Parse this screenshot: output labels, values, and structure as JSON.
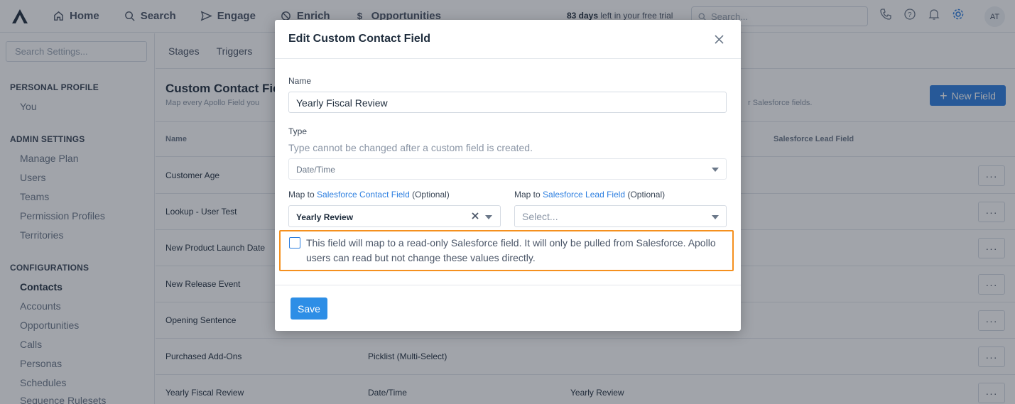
{
  "topbar": {
    "nav": [
      {
        "label": "Home",
        "icon": "home-icon"
      },
      {
        "label": "Search",
        "icon": "search-icon"
      },
      {
        "label": "Engage",
        "icon": "send-icon"
      },
      {
        "label": "Enrich",
        "icon": "enrich-icon"
      },
      {
        "label": "Opportunities",
        "icon": "dollar-icon"
      }
    ],
    "trial_days": "83 days",
    "trial_rest": " left in your free trial",
    "search_placeholder": "Search...",
    "avatar_initials": "AT"
  },
  "sidebar": {
    "search_placeholder": "Search Settings...",
    "sections": [
      {
        "title": "PERSONAL PROFILE",
        "items": [
          "You"
        ]
      },
      {
        "title": "ADMIN SETTINGS",
        "items": [
          "Manage Plan",
          "Users",
          "Teams",
          "Permission Profiles",
          "Territories"
        ]
      },
      {
        "title": "CONFIGURATIONS",
        "items": [
          "Contacts",
          "Accounts",
          "Opportunities",
          "Calls",
          "Personas",
          "Schedules",
          "Sequence Rulesets"
        ]
      }
    ],
    "active_item": "Contacts"
  },
  "main": {
    "tabs": [
      "Stages",
      "Triggers"
    ],
    "title": "Custom Contact Fie",
    "subtitle": "Map every Apollo Field you",
    "subtitle_right": "r Salesforce fields.",
    "new_field_label": "New Field",
    "columns": {
      "name": "Name",
      "lead": "Salesforce Lead Field"
    },
    "rows": [
      {
        "name": "Customer Age",
        "type": "",
        "contact": ""
      },
      {
        "name": "Lookup - User Test",
        "type": "",
        "contact": ""
      },
      {
        "name": "New Product Launch Date",
        "type": "",
        "contact": ""
      },
      {
        "name": "New Release Event",
        "type": "",
        "contact": ""
      },
      {
        "name": "Opening Sentence",
        "type": "",
        "contact": ""
      },
      {
        "name": "Purchased Add-Ons",
        "type": "Picklist (Multi-Select)",
        "contact": ""
      },
      {
        "name": "Yearly Fiscal Review",
        "type": "Date/Time",
        "contact": "Yearly Review"
      }
    ],
    "row_menu": "···"
  },
  "modal": {
    "title": "Edit Custom Contact Field",
    "name_label": "Name",
    "name_value": "Yearly Fiscal Review",
    "type_label": "Type",
    "type_note": "Type cannot be changed after a custom field is created.",
    "type_value": "Date/Time",
    "contact_map": {
      "prefix": "Map to ",
      "link": "Salesforce Contact Field",
      "suffix": " (Optional)",
      "value": "Yearly Review"
    },
    "lead_map": {
      "prefix": "Map to ",
      "link": "Salesforce Lead Field",
      "suffix": " (Optional)",
      "placeholder": "Select..."
    },
    "readonly_checkbox": {
      "checked": false,
      "text": "This field will map to a read-only Salesforce field. It will only be pulled from Salesforce. Apollo users can read but not change these values directly."
    },
    "save_label": "Save"
  },
  "colors": {
    "accent": "#2d7fe0",
    "highlight": "#f5901e",
    "overlay": "rgba(30,38,52,0.42)"
  }
}
